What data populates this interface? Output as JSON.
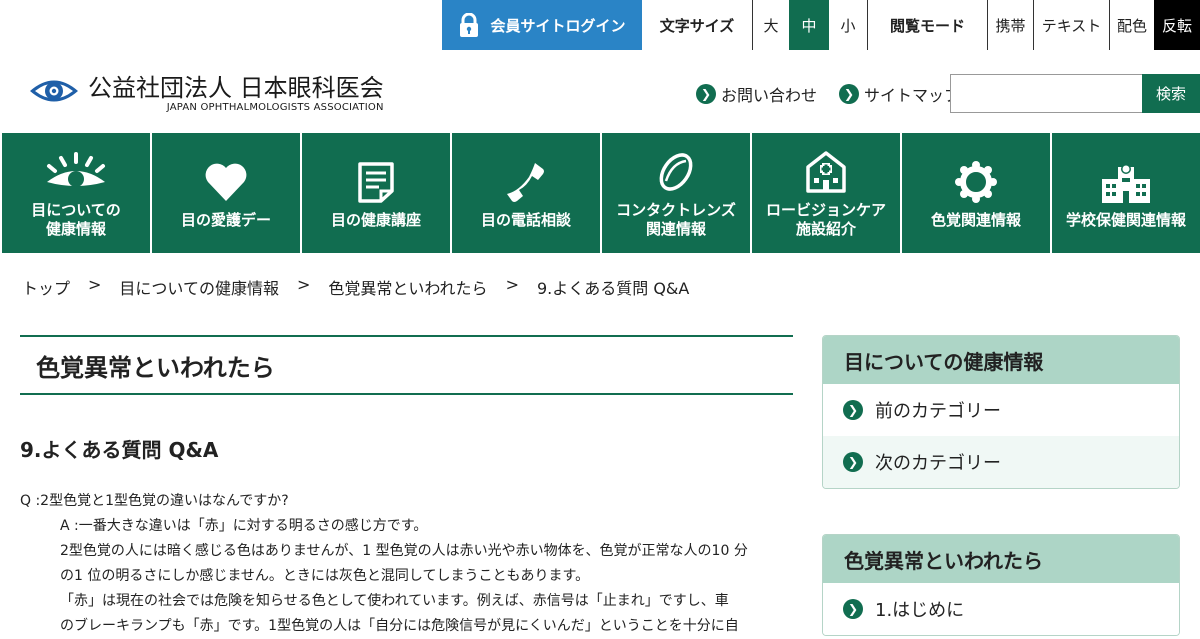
{
  "utility": {
    "login_label": "会員サイトログイン",
    "font_size_label": "文字サイズ",
    "size_large": "大",
    "size_medium": "中",
    "size_small": "小",
    "view_mode_label": "閲覧モード",
    "mode_mobile": "携帯",
    "mode_text": "テキスト",
    "mode_color": "配色",
    "mode_invert": "反転",
    "selected_size": "中"
  },
  "logo": {
    "title": "公益社団法人 日本眼科医会",
    "subtitle": "JAPAN OPHTHALMOLOGISTS ASSOCIATION",
    "icon": "eye-logo-icon"
  },
  "header": {
    "contact_label": "お問い合わせ",
    "sitemap_label": "サイトマップ",
    "search_value": "",
    "search_button": "検索"
  },
  "nav": {
    "items": [
      {
        "label": "目についての\n健康情報",
        "icon": "eye-icon"
      },
      {
        "label": "目の愛護デー",
        "icon": "heart-icon"
      },
      {
        "label": "目の健康講座",
        "icon": "document-icon"
      },
      {
        "label": "目の電話相談",
        "icon": "phone-icon"
      },
      {
        "label": "コンタクトレンズ\n関連情報",
        "icon": "contact-lens-icon"
      },
      {
        "label": "ロービジョンケア\n施設紹介",
        "icon": "facility-icon"
      },
      {
        "label": "色覚関連情報",
        "icon": "color-ring-icon"
      },
      {
        "label": "学校保健関連情報",
        "icon": "school-icon"
      }
    ]
  },
  "breadcrumb": {
    "items": [
      "トップ",
      "目についての健康情報",
      "色覚異常といわれたら",
      "9.よくある質問 Q&A"
    ],
    "separator": ">"
  },
  "main": {
    "page_title": "色覚異常といわれたら",
    "section_title": "9.よくある質問 Q&A",
    "question": "Q :2型色覚と1型色覚の違いはなんですか?",
    "answer_lines": [
      "A :一番大きな違いは「赤」に対する明るさの感じ方です。",
      "2型色覚の人には暗く感じる色はありませんが、1 型色覚の人は赤い光や赤い物体を、色覚が正常な人の10 分",
      "の1 位の明るさにしか感じません。ときには灰色と混同してしまうこともあります。",
      "「赤」は現在の社会では危険を知らせる色として使われています。例えば、赤信号は「止まれ」ですし、車",
      "のブレーキランプも「赤」です。1型色覚の人は「自分には危険信号が見にくいんだ」ということを十分に自"
    ]
  },
  "sidebar": {
    "box1": {
      "title": "目についての健康情報",
      "items": [
        "前のカテゴリー",
        "次のカテゴリー"
      ]
    },
    "box2": {
      "title": "色覚異常といわれたら",
      "items": [
        "1.はじめに"
      ]
    }
  },
  "colors": {
    "primary_green": "#116d50",
    "login_blue": "#2a84c6",
    "sidebar_header": "#add5c6",
    "invert_black": "#000000"
  }
}
